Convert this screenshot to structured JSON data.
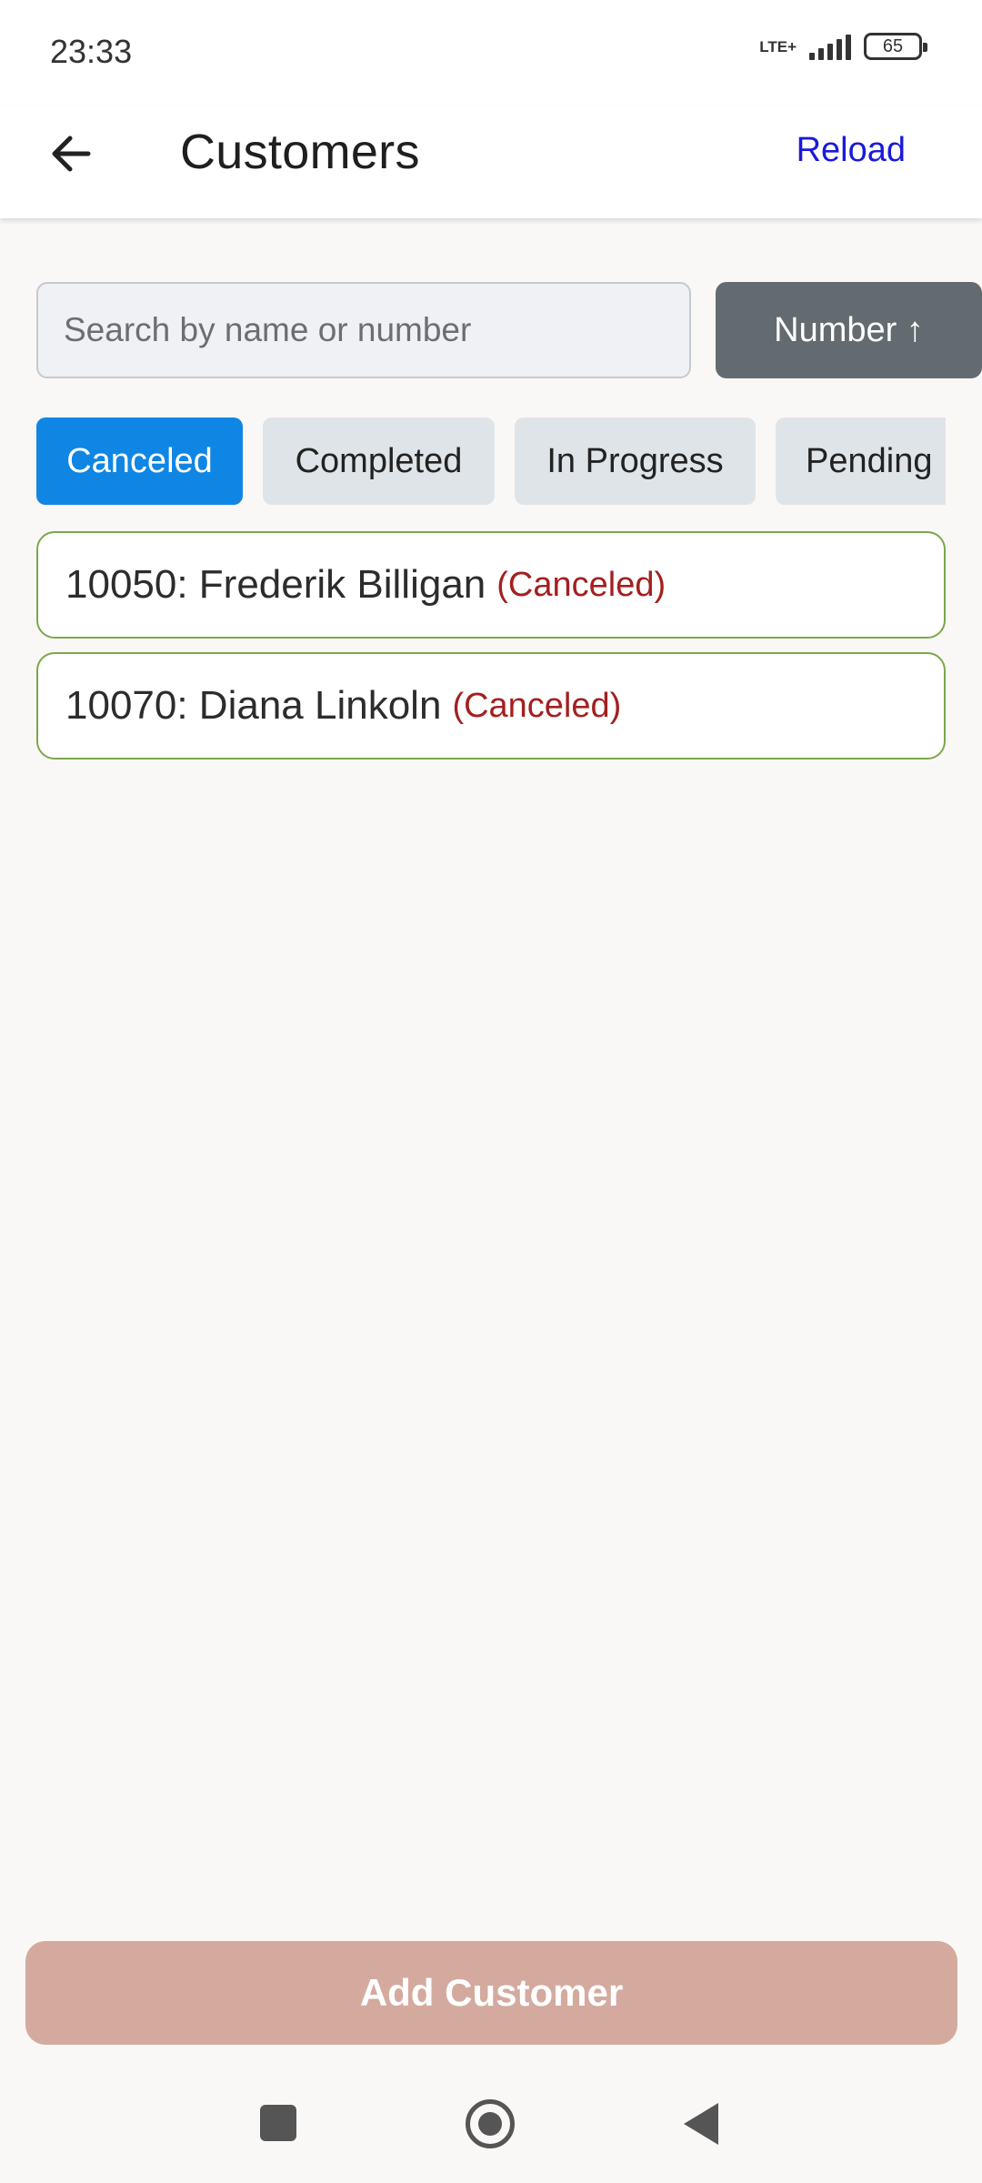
{
  "status_bar": {
    "time": "23:33",
    "network": "LTE+",
    "battery": "65"
  },
  "app_bar": {
    "title": "Customers",
    "reload_label": "Reload",
    "back_icon": "arrow-left-icon"
  },
  "search": {
    "placeholder": "Search by name or number",
    "value": ""
  },
  "sort": {
    "label": "Number ↑"
  },
  "filters": [
    {
      "label": "Canceled",
      "active": true
    },
    {
      "label": "Completed",
      "active": false
    },
    {
      "label": "In Progress",
      "active": false
    },
    {
      "label": "Pending",
      "active": false
    }
  ],
  "customers": [
    {
      "number_name": "10050: Frederik Billigan",
      "status": "(Canceled)"
    },
    {
      "number_name": "10070: Diana Linkoln",
      "status": "(Canceled)"
    }
  ],
  "add_button": {
    "label": "Add Customer"
  },
  "colors": {
    "accent": "#0f86e3",
    "link": "#1a1adb",
    "item_border": "#7aa84a",
    "status_text": "#a3201f",
    "add_button_bg": "#d4aa9f",
    "sort_button_bg": "#636b70"
  }
}
